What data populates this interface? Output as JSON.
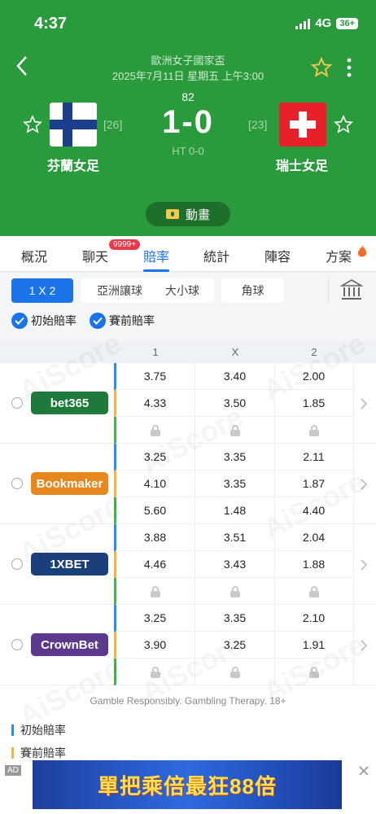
{
  "status_bar": {
    "time": "4:37",
    "network": "4G",
    "battery": "36+"
  },
  "match": {
    "league": "歐洲女子國家盃",
    "datetime": "2025年7月11日 星期五 上午3:00",
    "minute": "82",
    "score": "1-0",
    "halftime": "HT 0-0",
    "home": {
      "name": "芬蘭女足",
      "rank": "[26]"
    },
    "away": {
      "name": "瑞士女足",
      "rank": "[23]"
    },
    "animation_label": "動畫"
  },
  "tabs": [
    {
      "label": "概況"
    },
    {
      "label": "聊天"
    },
    {
      "label": "賠率"
    },
    {
      "label": "統計"
    },
    {
      "label": "陣容"
    },
    {
      "label": "方案"
    }
  ],
  "chat_badge": "9999+",
  "filters": {
    "markets": [
      "1 X 2",
      "亞洲讓球",
      "大小球",
      "角球"
    ],
    "checks": [
      "初始賠率",
      "賽前賠率"
    ]
  },
  "columns": [
    "1",
    "X",
    "2"
  ],
  "bookmakers": [
    {
      "name": "bet365",
      "color": "#1d7a3a",
      "rows": [
        [
          "3.75",
          "3.40",
          "2.00"
        ],
        [
          "4.33",
          "3.50",
          "1.85"
        ],
        [
          "lock",
          "lock",
          "lock"
        ]
      ]
    },
    {
      "name": "Bookmaker",
      "color": "#e8871e",
      "rows": [
        [
          "3.25",
          "3.35",
          "2.11"
        ],
        [
          "4.10",
          "3.35",
          "1.87"
        ],
        [
          "5.60",
          "1.48",
          "4.40"
        ]
      ]
    },
    {
      "name": "1XBET",
      "color": "#1b3f7a",
      "rows": [
        [
          "3.88",
          "3.51",
          "2.04"
        ],
        [
          "4.46",
          "3.43",
          "1.88"
        ],
        [
          "lock",
          "lock",
          "lock"
        ]
      ]
    },
    {
      "name": "CrownBet",
      "color": "#5b3a8e",
      "rows": [
        [
          "3.25",
          "3.35",
          "2.10"
        ],
        [
          "3.90",
          "3.25",
          "1.91"
        ],
        [
          "lock",
          "lock",
          "lock"
        ]
      ]
    }
  ],
  "row_colors": [
    "#2b8ee8",
    "#f2b441",
    "#49b04a"
  ],
  "watermark": "AiScore",
  "footer": {
    "gamble": "Gamble Responsibly. Gambling Therapy. 18+",
    "legend": [
      {
        "label": "初始賠率",
        "color": "#2b8ee8"
      },
      {
        "label": "賽前賠率",
        "color": "#f2b441"
      }
    ]
  },
  "ad": {
    "tag": "AD",
    "text": "單把乘倍最狂88倍"
  }
}
